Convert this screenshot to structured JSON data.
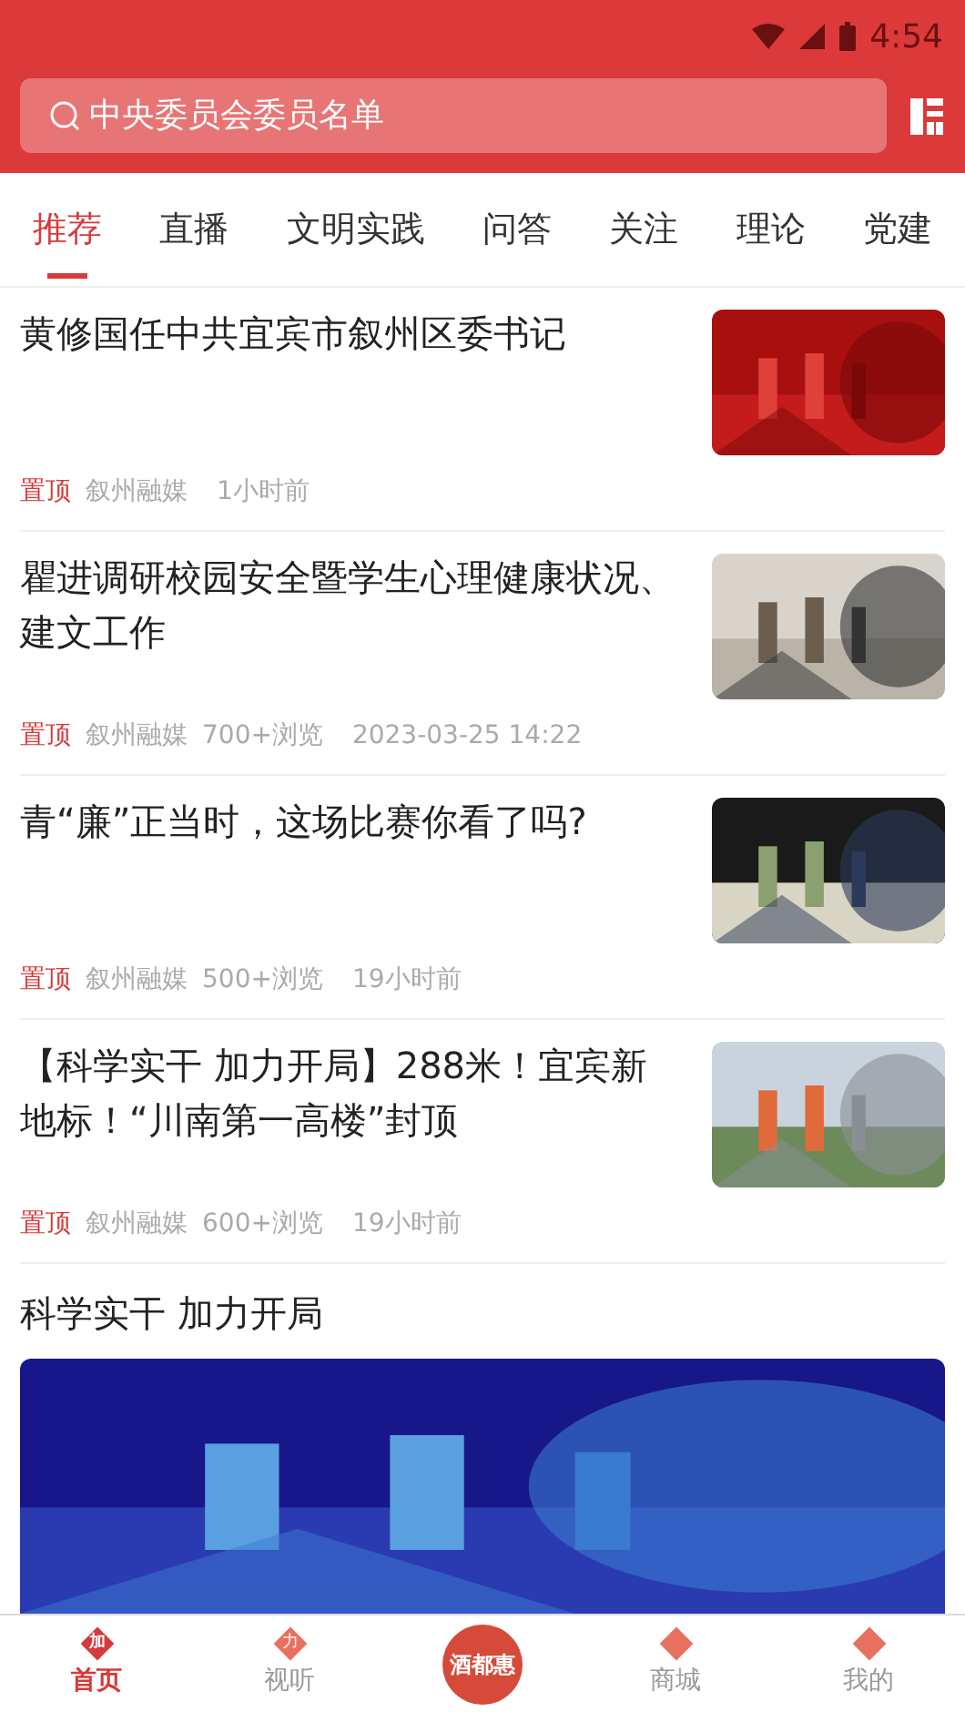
{
  "status_bar": {
    "time": "4:54"
  },
  "search": {
    "placeholder": "中央委员会委员名单"
  },
  "tabs": [
    {
      "label": "推荐",
      "selected": true
    },
    {
      "label": "直播",
      "selected": false
    },
    {
      "label": "文明实践",
      "selected": false
    },
    {
      "label": "问答",
      "selected": false
    },
    {
      "label": "关注",
      "selected": false
    },
    {
      "label": "理论",
      "selected": false
    },
    {
      "label": "党建",
      "selected": false
    }
  ],
  "articles": [
    {
      "title": "黄修国任中共宜宾市叙州区委书记",
      "tag": "置顶",
      "source": "叙州融媒",
      "time": "1小时前"
    },
    {
      "title": "瞿进调研校园安全暨学生心理健康状况、建文工作",
      "tag": "置顶",
      "source": "叙州融媒",
      "views": "700+浏览",
      "time": "2023-03-25 14:22"
    },
    {
      "title": "青“廉”正当时，这场比赛你看了吗?",
      "tag": "置顶",
      "source": "叙州融媒",
      "views": "500+浏览",
      "time": "19小时前"
    },
    {
      "title": "【科学实干 加力开局】288米！宜宾新地标！“川南第一高楼”封顶",
      "tag": "置顶",
      "source": "叙州融媒",
      "views": "600+浏览",
      "time": "19小时前"
    }
  ],
  "section": {
    "title": "科学实干 加力开局"
  },
  "bottom_nav": [
    {
      "label": "首页",
      "selected": true,
      "kind": "tab",
      "badge": "加"
    },
    {
      "label": "视听",
      "selected": false,
      "kind": "tab",
      "badge": "力"
    },
    {
      "label": "酒都惠",
      "selected": false,
      "kind": "center"
    },
    {
      "label": "商城",
      "selected": false,
      "kind": "tab"
    },
    {
      "label": "我的",
      "selected": false,
      "kind": "tab"
    }
  ]
}
